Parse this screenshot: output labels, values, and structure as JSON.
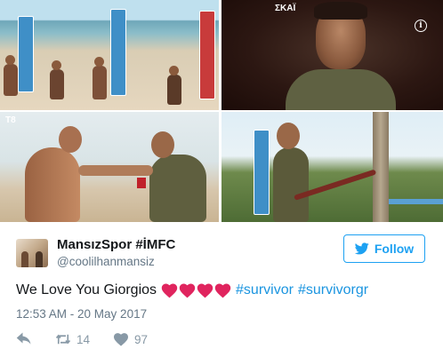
{
  "media": {
    "photo_1_alt": "",
    "photo_2_watermark": "ΣΚΑΪ",
    "photo_3_watermark": "T8"
  },
  "tweet": {
    "display_name": "MansızSpor #İMFC",
    "handle": "@coolilhanmansiz",
    "follow_label": "Follow",
    "text_before": "We Love You Giorgios",
    "hearts_count": 4,
    "hashtags": [
      "#survivor",
      "#survivorgr"
    ],
    "timestamp": "12:53 AM - 20 May 2017",
    "retweet_count": "14",
    "like_count": "97"
  },
  "colors": {
    "accent": "#1da1f2",
    "hashtag": "#1b95e0",
    "heart": "#e0245e",
    "muted": "#657786",
    "icon": "#8899a6"
  },
  "icons": {
    "follow": "twitter-bird-icon",
    "reply": "reply-icon",
    "retweet": "retweet-icon",
    "like": "heart-icon",
    "info": "info-icon"
  }
}
